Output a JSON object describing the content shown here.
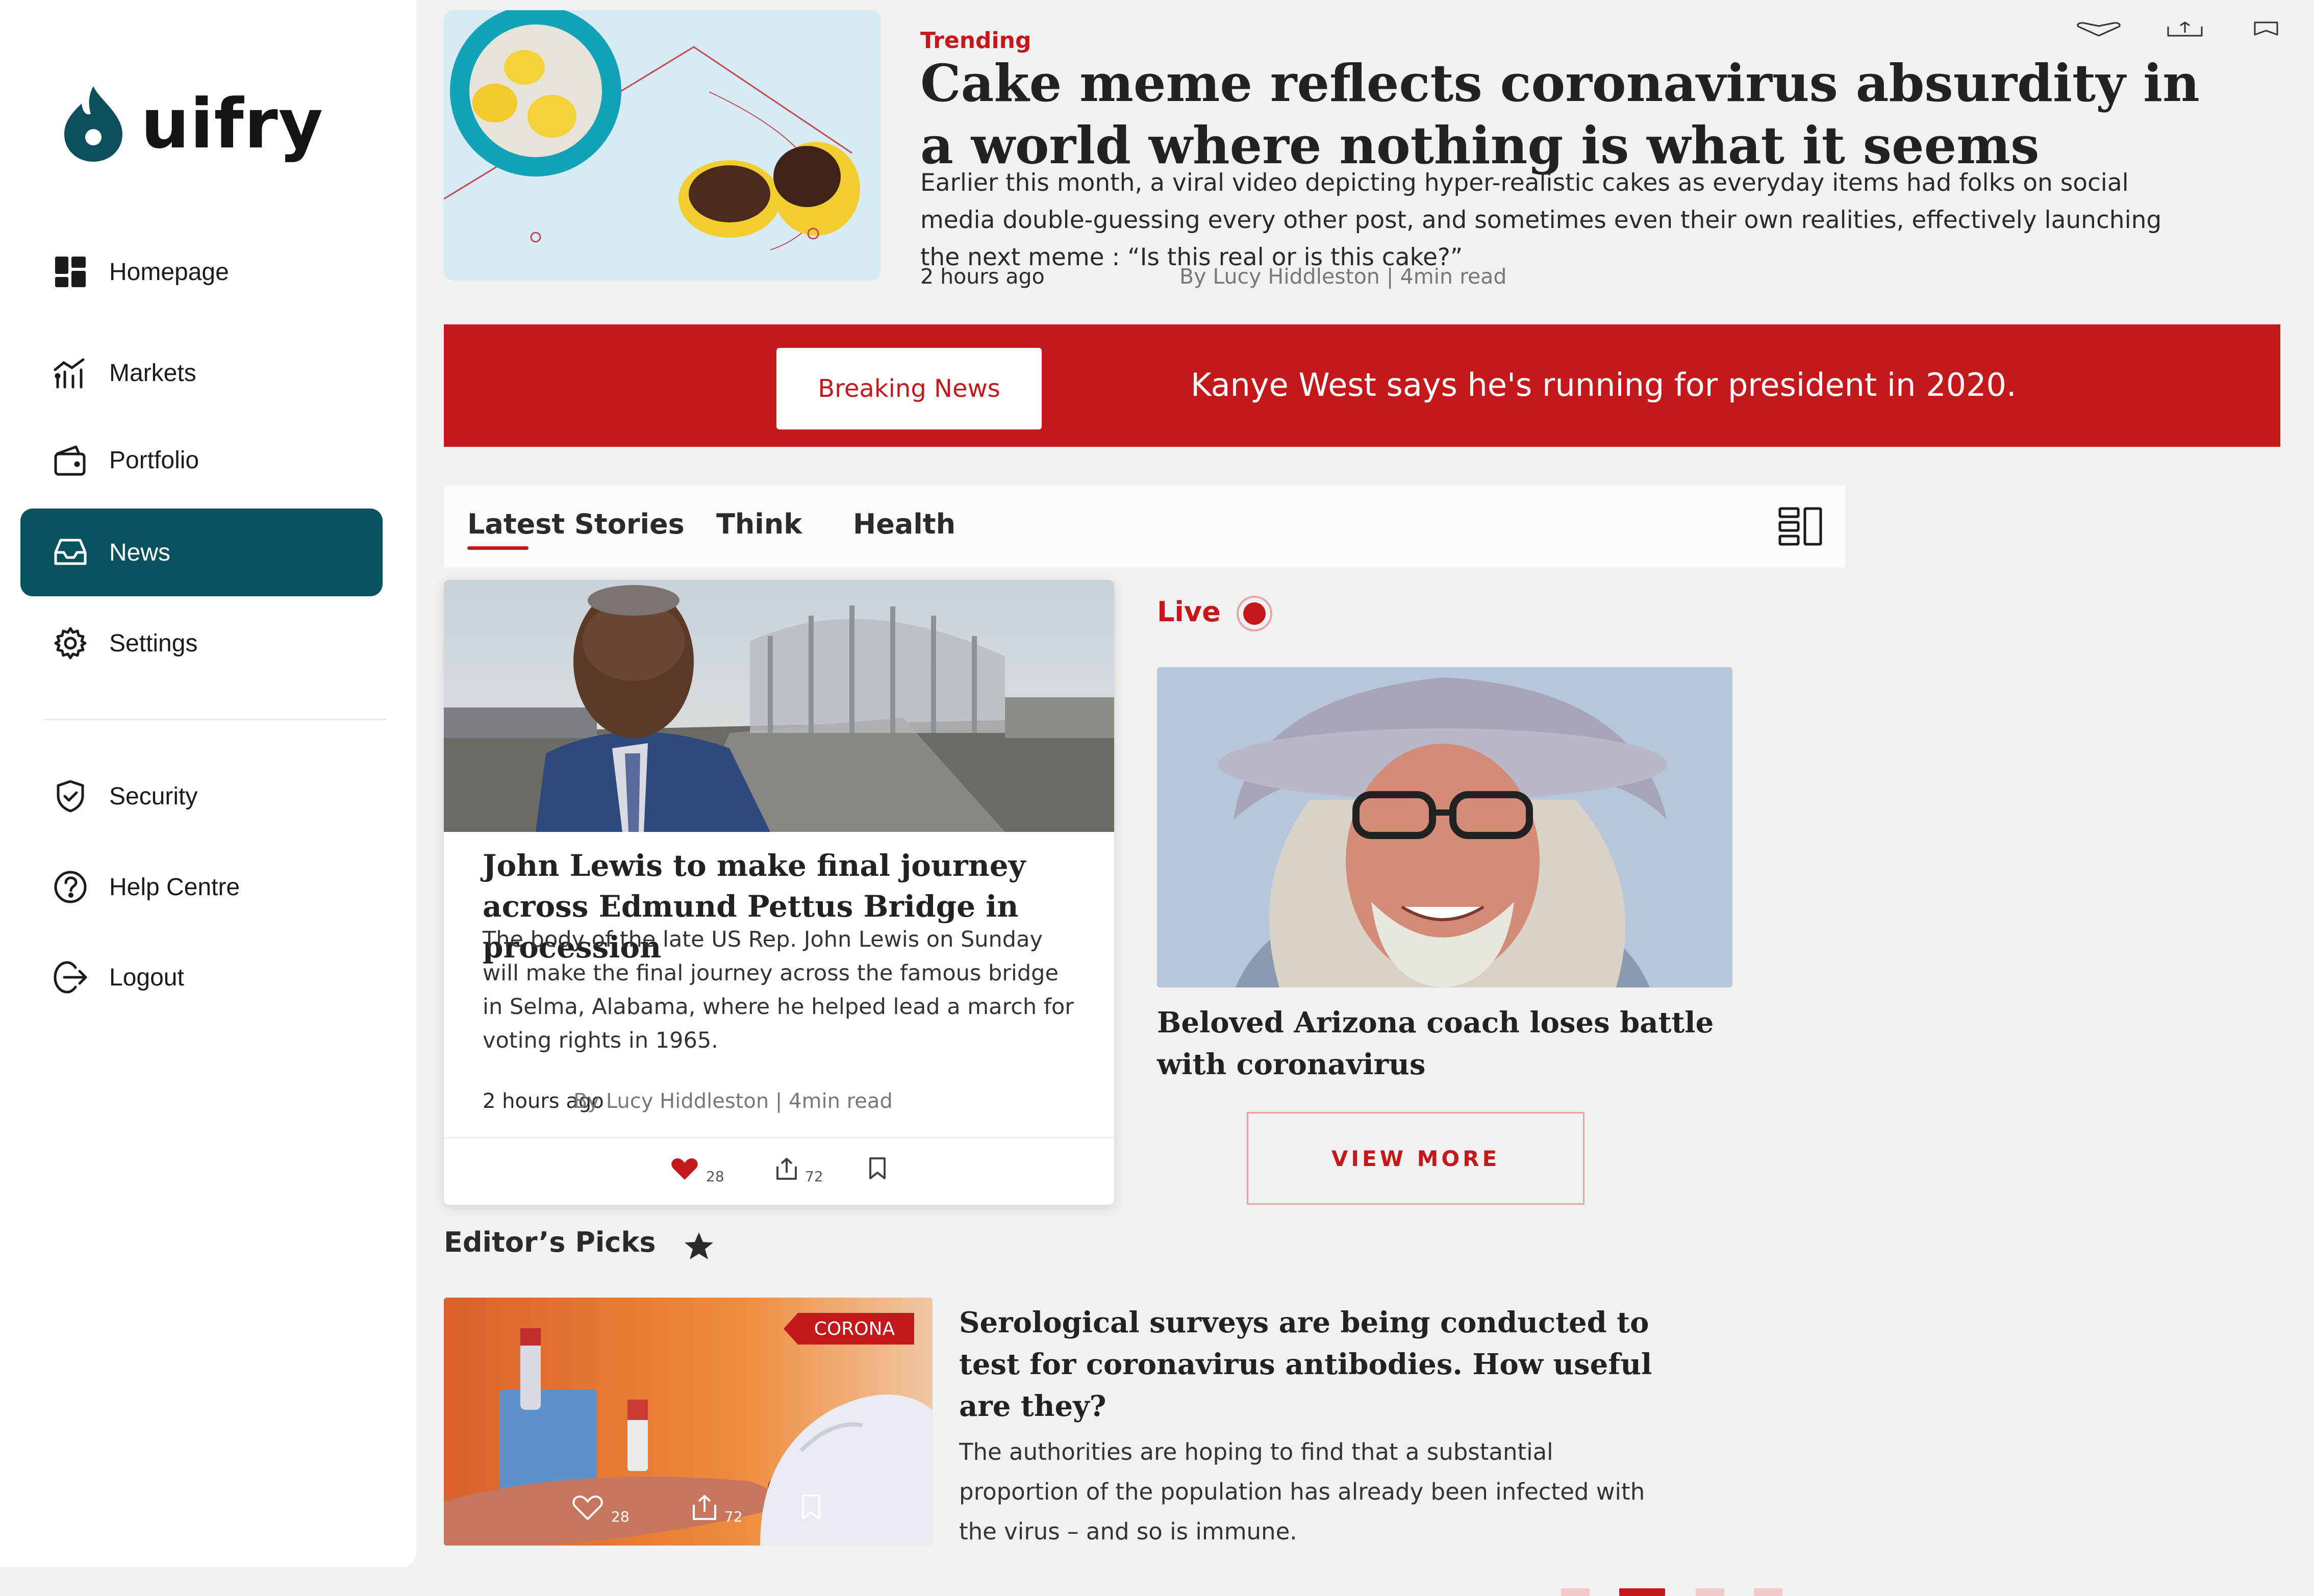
{
  "brand": {
    "name": "uifry",
    "color": "#0b4f5c"
  },
  "colors": {
    "accent": "#c5181b",
    "nav_active": "#08525f"
  },
  "sidebar": {
    "items": [
      {
        "label": "Homepage",
        "icon": "dashboard-grid-icon",
        "active": false
      },
      {
        "label": "Markets",
        "icon": "market-chart-icon",
        "active": false
      },
      {
        "label": "Portfolio",
        "icon": "wallet-icon",
        "active": false
      },
      {
        "label": "News",
        "icon": "inbox-tray-icon",
        "active": true
      },
      {
        "label": "Settings",
        "icon": "gear-icon",
        "active": false
      }
    ],
    "secondary": [
      {
        "label": "Security",
        "icon": "shield-check-icon"
      },
      {
        "label": "Help Centre",
        "icon": "help-circle-icon"
      },
      {
        "label": "Logout",
        "icon": "logout-icon"
      }
    ]
  },
  "trending": {
    "label": "Trending",
    "title": "Cake meme reflects coronavirus absurdity in a world where nothing is what it seems",
    "description": "Earlier this month, a viral video depicting hyper-realistic cakes as everyday items had folks on social media double-guessing every other post, and sometimes even their own realities, effectively launching the next meme : “Is this real or is this cake?”",
    "time": "2 hours ago",
    "byline": "By Lucy Hiddleston  |  4min read",
    "image": "lemons-cake-illustration",
    "actions": [
      "heart-icon",
      "share-icon",
      "bookmark-icon"
    ]
  },
  "breaking": {
    "button_label": "Breaking News",
    "headline": "Kanye West says he's running for president in 2020."
  },
  "tabs": {
    "items": [
      "Latest Stories",
      "Think",
      "Health"
    ],
    "active_index": 0,
    "layout_icon": "layout-toggle-icon"
  },
  "story_card": {
    "image": "john-lewis-bridge-photo",
    "title": "John Lewis to make final journey across Edmund Pettus Bridge in procession",
    "description": "The body of the late US Rep. John Lewis on Sunday will make the final journey across the famous bridge in Selma, Alabama, where he helped lead a march for voting rights in 1965.",
    "time": "2 hours ago",
    "byline": "By Lucy Hiddleston  |  4min read",
    "likes": "28",
    "shares": "72",
    "liked": true
  },
  "live": {
    "label": "Live",
    "image": "coach-portrait-photo",
    "title": "Beloved Arizona coach loses battle with coronavirus",
    "button_label": "VIEW MORE"
  },
  "editors_picks": {
    "title": "Editor’s Picks",
    "icon": "star-icon",
    "tag": "CORONA",
    "image": "blood-test-photo",
    "likes": "28",
    "shares": "72",
    "headline": "Serological surveys are being conducted to test for coronavirus antibodies. How useful are they?",
    "description": "The authorities are hoping to find that a substantial proportion of the population has already been infected with the virus – and so is immune."
  },
  "pagination": {
    "pages": 4,
    "active_index": 1
  }
}
